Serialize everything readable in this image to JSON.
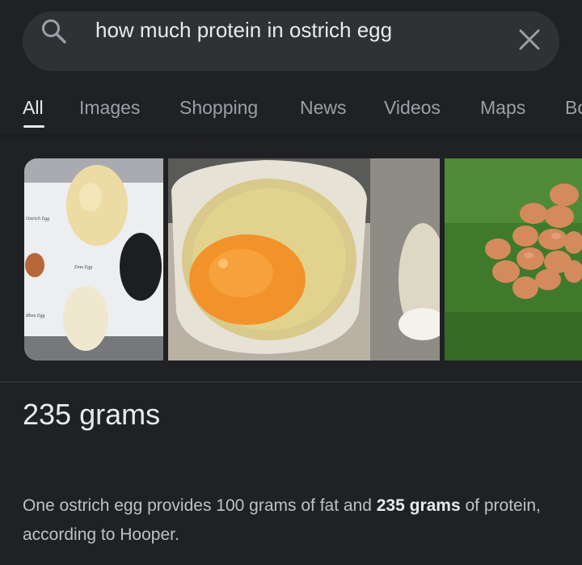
{
  "search": {
    "query": "how much protein in ostrich egg",
    "search_icon": "search-icon",
    "clear_icon": "close-icon"
  },
  "tabs": [
    {
      "label": "All",
      "active": true
    },
    {
      "label": "Images"
    },
    {
      "label": "Shopping"
    },
    {
      "label": "News"
    },
    {
      "label": "Videos"
    },
    {
      "label": "Maps"
    },
    {
      "label": "Bo"
    }
  ],
  "images": {
    "items": [
      {
        "kind": "egg-comparison-photo",
        "labels": [
          "Ostrich Egg",
          "Emu Egg",
          "Rhea Egg"
        ]
      },
      {
        "kind": "cracked-egg-in-bowl-photo"
      },
      {
        "kind": "ostrich-egg-partial-photo"
      },
      {
        "kind": "eggs-on-grass-photo"
      }
    ]
  },
  "answer": {
    "value": "235 grams"
  },
  "snippet": {
    "part1": "One ostrich egg provides 100 grams of fat and ",
    "highlight": "235 grams",
    "part2": " of protein, according to Hooper."
  },
  "colors": {
    "background": "#202124",
    "search_bar": "#303134",
    "text_primary": "#e8eaed",
    "text_secondary": "#9aa0a6",
    "yolk": "#f5941e"
  }
}
